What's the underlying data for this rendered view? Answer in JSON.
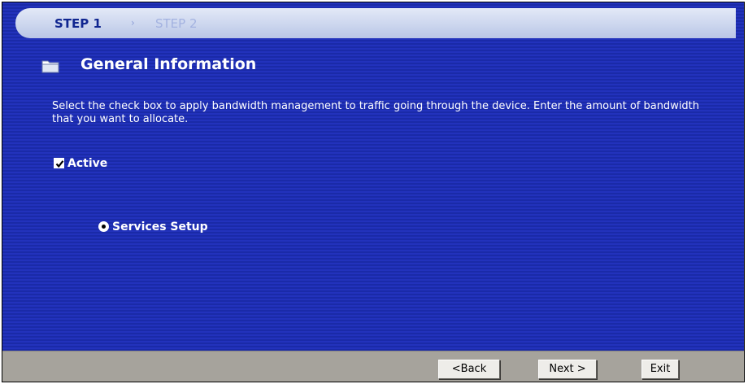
{
  "wizard": {
    "steps": [
      {
        "label": "STEP 1",
        "state": "current"
      },
      {
        "label": "STEP 2",
        "state": "upcoming"
      }
    ],
    "step_separator": "›"
  },
  "section": {
    "title": "General Information",
    "icon": "folder-icon",
    "description": "Select the check box to apply bandwidth management to traffic going through the device. Enter the amount of bandwidth that you want to allocate."
  },
  "form": {
    "active": {
      "label": "Active",
      "checked": true
    },
    "services_setup": {
      "label": "Services Setup",
      "selected": true
    }
  },
  "buttons": {
    "back": "<Back",
    "next": "Next >",
    "exit": "Exit"
  },
  "colors": {
    "background": "#1f2fb4",
    "step_bar": "#ccd6ee",
    "step_active_text": "#102690",
    "footer": "#a6a39c",
    "button_face": "#eeede9"
  }
}
